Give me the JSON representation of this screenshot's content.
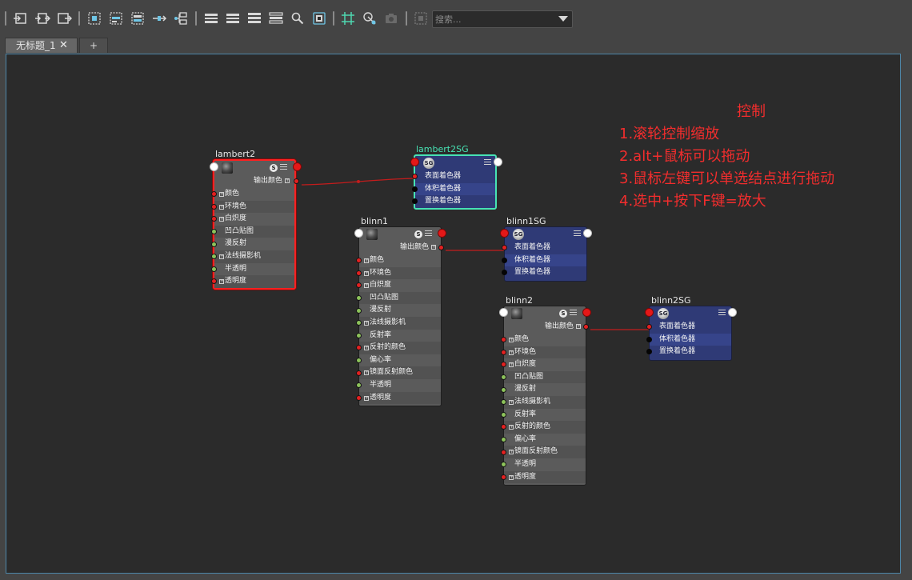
{
  "toolbar": {
    "search": {
      "placeholder": "搜索..."
    }
  },
  "tabs": {
    "document_label": "无标题_1",
    "close_glyph": "✕",
    "add_glyph": "+"
  },
  "nodes": {
    "lambert2": {
      "title": "lambert2",
      "out_label": "输出颜色",
      "attrs": [
        {
          "label": "颜色",
          "plus": true,
          "port": "red"
        },
        {
          "label": "环境色",
          "plus": true,
          "port": "red"
        },
        {
          "label": "白炽度",
          "plus": true,
          "port": "red"
        },
        {
          "label": "凹凸贴图",
          "plus": false,
          "port": "green"
        },
        {
          "label": "漫反射",
          "plus": false,
          "port": "green"
        },
        {
          "label": "法线摄影机",
          "plus": true,
          "port": "green"
        },
        {
          "label": "半透明",
          "plus": false,
          "port": "green"
        },
        {
          "label": "透明度",
          "plus": true,
          "port": "red"
        }
      ]
    },
    "lambert2SG": {
      "title": "lambert2SG",
      "attrs": [
        {
          "label": "表面着色器",
          "port": "red"
        },
        {
          "label": "体积着色器",
          "port": "black"
        },
        {
          "label": "置换着色器",
          "port": "black"
        }
      ]
    },
    "blinn1": {
      "title": "blinn1",
      "out_label": "输出颜色",
      "attrs": [
        {
          "label": "颜色",
          "plus": true,
          "port": "red"
        },
        {
          "label": "环境色",
          "plus": true,
          "port": "red"
        },
        {
          "label": "白炽度",
          "plus": true,
          "port": "red"
        },
        {
          "label": "凹凸贴图",
          "plus": false,
          "port": "green"
        },
        {
          "label": "漫反射",
          "plus": false,
          "port": "green"
        },
        {
          "label": "法线摄影机",
          "plus": true,
          "port": "green"
        },
        {
          "label": "反射率",
          "plus": false,
          "port": "green"
        },
        {
          "label": "反射的颜色",
          "plus": true,
          "port": "red"
        },
        {
          "label": "偏心率",
          "plus": false,
          "port": "green"
        },
        {
          "label": "镜面反射颜色",
          "plus": true,
          "port": "red"
        },
        {
          "label": "半透明",
          "plus": false,
          "port": "green"
        },
        {
          "label": "透明度",
          "plus": true,
          "port": "red"
        }
      ]
    },
    "blinn1SG": {
      "title": "blinn1SG",
      "attrs": [
        {
          "label": "表面着色器",
          "port": "red"
        },
        {
          "label": "体积着色器",
          "port": "black"
        },
        {
          "label": "置换着色器",
          "port": "black"
        }
      ]
    },
    "blinn2": {
      "title": "blinn2",
      "out_label": "输出颜色",
      "attrs": [
        {
          "label": "颜色",
          "plus": true,
          "port": "red"
        },
        {
          "label": "环境色",
          "plus": true,
          "port": "red"
        },
        {
          "label": "白炽度",
          "plus": true,
          "port": "red"
        },
        {
          "label": "凹凸贴图",
          "plus": false,
          "port": "green"
        },
        {
          "label": "漫反射",
          "plus": false,
          "port": "green"
        },
        {
          "label": "法线摄影机",
          "plus": true,
          "port": "green"
        },
        {
          "label": "反射率",
          "plus": false,
          "port": "green"
        },
        {
          "label": "反射的颜色",
          "plus": true,
          "port": "red"
        },
        {
          "label": "偏心率",
          "plus": false,
          "port": "green"
        },
        {
          "label": "镜面反射颜色",
          "plus": true,
          "port": "red"
        },
        {
          "label": "半透明",
          "plus": false,
          "port": "green"
        },
        {
          "label": "透明度",
          "plus": true,
          "port": "red"
        }
      ]
    },
    "blinn2SG": {
      "title": "blinn2SG",
      "attrs": [
        {
          "label": "表面着色器",
          "port": "red"
        },
        {
          "label": "体积着色器",
          "port": "black"
        },
        {
          "label": "置换着色器",
          "port": "black"
        }
      ]
    }
  },
  "annotation": {
    "heading": "控制",
    "lines": [
      "1.滚轮控制缩放",
      "2.alt+鼠标可以拖动",
      "3.鼠标左键可以单选结点进行拖动",
      "4.选中+按下F键=放大"
    ]
  },
  "colors": {
    "canvas_bg": "#2b2b2b",
    "canvas_border": "#4d86a8",
    "material_node": "#5b5b5b",
    "shading_group_node": "#2f3a76",
    "wire": "#c41c1c",
    "annotation_text": "#f22d2d",
    "selected_red": "#ff2020",
    "selected_green": "#47e3b4"
  }
}
